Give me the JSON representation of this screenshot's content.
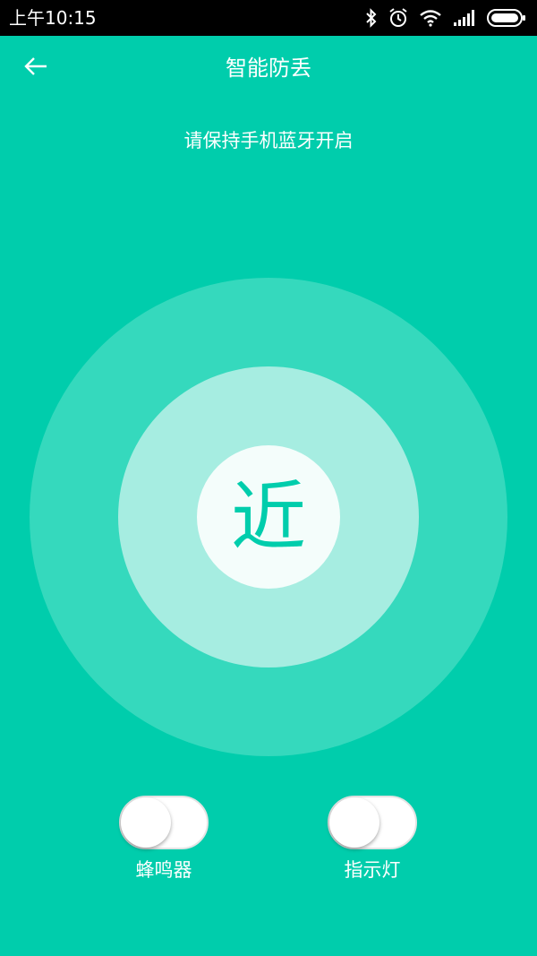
{
  "status_bar": {
    "time": "上午10:15",
    "icons": [
      "bluetooth-icon",
      "alarm-icon",
      "wifi-icon",
      "signal-icon",
      "battery-icon"
    ]
  },
  "app_bar": {
    "back_icon": "arrow-left-icon",
    "title": "智能防丢"
  },
  "hint": "请保持手机蓝牙开启",
  "proximity": {
    "label": "近"
  },
  "toggles": [
    {
      "label": "蜂鸣器",
      "on": false
    },
    {
      "label": "指示灯",
      "on": false
    }
  ],
  "colors": {
    "background": "#00cdac",
    "outer_ring": "#35d9bd",
    "middle_ring": "#a6ede1",
    "center": "#f4fdfb",
    "accent_text": "#00cdac"
  }
}
